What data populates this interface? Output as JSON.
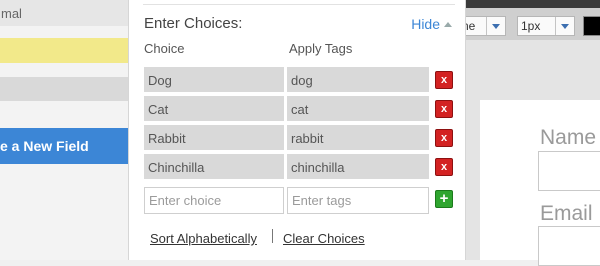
{
  "left_sidebar": {
    "top_label": "mal",
    "create_button_label": "e a New Field"
  },
  "choices_panel": {
    "title": "Enter Choices:",
    "hide_label": "Hide",
    "choice_header": "Choice",
    "tags_header": "Apply Tags",
    "rows": [
      {
        "choice": "Dog",
        "tags": "dog"
      },
      {
        "choice": "Cat",
        "tags": "cat"
      },
      {
        "choice": "Rabbit",
        "tags": "rabbit"
      },
      {
        "choice": "Chinchilla",
        "tags": "chinchilla"
      }
    ],
    "delete_label": "x",
    "add_label": "+",
    "choice_placeholder": "Enter choice",
    "tags_placeholder": "Enter tags",
    "sort_label": "Sort Alphabetically",
    "clear_label": "Clear Choices"
  },
  "editor": {
    "line_style_value": "ne",
    "line_width_value": "1px",
    "color_value": "#000000",
    "canvas_label_1": "Name",
    "canvas_label_2": "Email"
  },
  "icons": {
    "delete": "close-icon",
    "add": "plus-icon",
    "hide_caret": "caret-up-icon",
    "dropdown": "chevron-down-icon"
  },
  "colors": {
    "accent": "#3c86d6",
    "delete": "#d32222",
    "add": "#2fa52f",
    "highlight": "#f2e98a"
  }
}
